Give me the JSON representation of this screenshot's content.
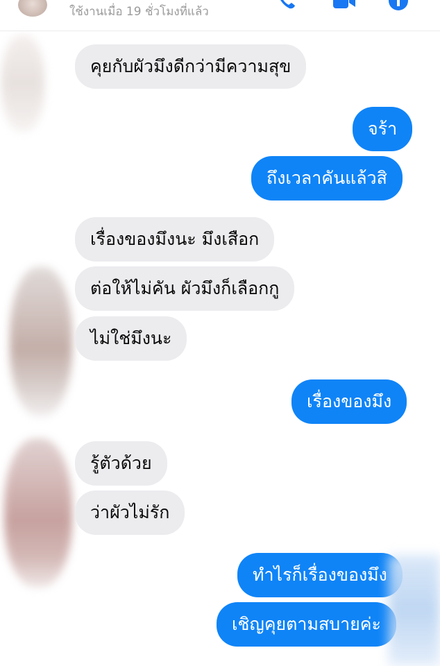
{
  "header": {
    "status": "ใช้งานเมื่อ 19 ชั่วโมงที่แล้ว",
    "icons": [
      "phone-icon",
      "video-call-icon",
      "info-icon"
    ]
  },
  "colors": {
    "accent": "#0f84f7",
    "incoming_bubble": "#ececef",
    "header_icon": "#1877f2"
  },
  "messages": [
    {
      "direction": "incoming",
      "text": "คุยกับผัวมึงดีกว่ามีความสุข"
    },
    {
      "direction": "outgoing",
      "text": "จร้า"
    },
    {
      "direction": "outgoing",
      "text": "ถึงเวลาคันแล้วสิ"
    },
    {
      "direction": "incoming",
      "text": "เรื่องของมึงนะ มึงเสือก"
    },
    {
      "direction": "incoming",
      "text": "ต่อให้ไม่คัน ผัวมึงก็เลือกกู"
    },
    {
      "direction": "incoming",
      "text": "ไม่ใช่มึงนะ"
    },
    {
      "direction": "outgoing",
      "text": "เรื่องของมึง"
    },
    {
      "direction": "incoming",
      "text": "รู้ตัวด้วย"
    },
    {
      "direction": "incoming",
      "text": "ว่าผัวไม่รัก"
    },
    {
      "direction": "outgoing",
      "text": "ทำไรก็เรื่องของมึง"
    },
    {
      "direction": "outgoing",
      "text": "เชิญคุยตามสบายค่ะ"
    }
  ]
}
